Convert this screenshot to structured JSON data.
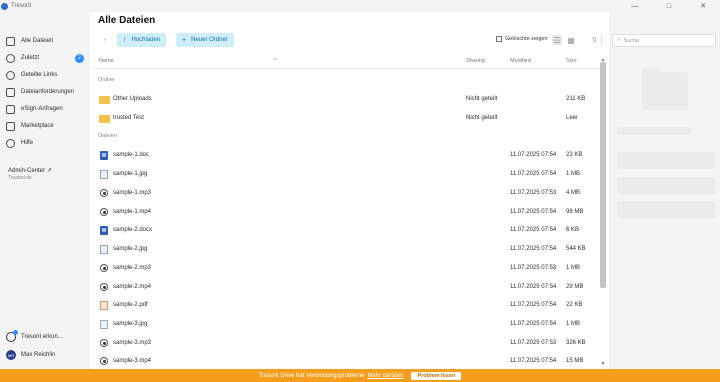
{
  "app": {
    "title": "Tresorit",
    "window_controls": [
      "—",
      "□",
      "✕"
    ]
  },
  "sidebar": {
    "items": [
      {
        "label": "Alle Dateien",
        "icon": "folder-icon"
      },
      {
        "label": "Zuletzt",
        "icon": "clock-icon",
        "badge": "2"
      },
      {
        "label": "Geteilte Links",
        "icon": "link-icon"
      },
      {
        "label": "Dateianforderungen",
        "icon": "inbox-icon"
      },
      {
        "label": "eSign-Anfragen",
        "icon": "signature-icon"
      },
      {
        "label": "Marketplace",
        "icon": "store-icon"
      },
      {
        "label": "Hilfe",
        "icon": "help-icon"
      }
    ],
    "admin": {
      "label": "Admin-Center",
      "sub": "Trusted.de"
    },
    "tour": "Tresorit erkun...",
    "user": {
      "name": "Max Reichlin",
      "initials": "MR"
    }
  },
  "main": {
    "title": "Alle Dateien",
    "toolbar": {
      "upload": "Hochladen",
      "new_folder": "Neuer Ordner",
      "show_deleted": "Gelöschte zeigen"
    },
    "columns": {
      "name": "Name",
      "sharing": "Sharing",
      "modified": "Modified",
      "size": "Size"
    },
    "sections": {
      "folders": "Ordner",
      "files": "Dateien"
    },
    "folders": [
      {
        "name": "Other Uploads",
        "sharing": "Nicht geteilt",
        "modified": "",
        "size": "211 KB"
      },
      {
        "name": "trusted Test",
        "sharing": "Nicht geteilt",
        "modified": "",
        "size": "Leer"
      }
    ],
    "files": [
      {
        "name": "sample-1.doc",
        "type": "doc",
        "modified": "11.07.2025 07:54",
        "size": "23 KB"
      },
      {
        "name": "sample-1.jpg",
        "type": "jpg",
        "modified": "11.07.2025 07:54",
        "size": "1 MB"
      },
      {
        "name": "sample-1.mp3",
        "type": "media",
        "modified": "11.07.2025 07:53",
        "size": "4 MB"
      },
      {
        "name": "sample-1.mp4",
        "type": "media",
        "modified": "11.07.2025 07:54",
        "size": "98 MB"
      },
      {
        "name": "sample-2.docx",
        "type": "doc",
        "modified": "11.07.2025 07:54",
        "size": "6 KB"
      },
      {
        "name": "sample-2.jpg",
        "type": "jpg",
        "modified": "11.07.2025 07:54",
        "size": "544 KB"
      },
      {
        "name": "sample-2.mp3",
        "type": "media",
        "modified": "11.07.2025 07:53",
        "size": "1 MB"
      },
      {
        "name": "sample-2.mp4",
        "type": "media",
        "modified": "11.07.2025 07:54",
        "size": "29 MB"
      },
      {
        "name": "sample-2.pdf",
        "type": "pdf",
        "modified": "11.07.2025 07:54",
        "size": "22 KB"
      },
      {
        "name": "sample-3.jpg",
        "type": "jpg",
        "modified": "11.07.2025 07:54",
        "size": "1 MB"
      },
      {
        "name": "sample-3.mp3",
        "type": "media",
        "modified": "11.07.2025 07:53",
        "size": "326 KB"
      },
      {
        "name": "sample-3.mp4",
        "type": "media",
        "modified": "11.07.2025 07:54",
        "size": "15 MB"
      }
    ]
  },
  "right_panel": {
    "search_placeholder": "Suche"
  },
  "footer": {
    "message": "Tresorit Drive hat Verbindungsprobleme",
    "more": "Mehr darüber",
    "fix": "Problem lösen"
  },
  "colors": {
    "accent": "#2d8cff",
    "button_bg": "#cdeefb",
    "warning_bar": "#f59e1b",
    "folder": "#f5c34b"
  }
}
